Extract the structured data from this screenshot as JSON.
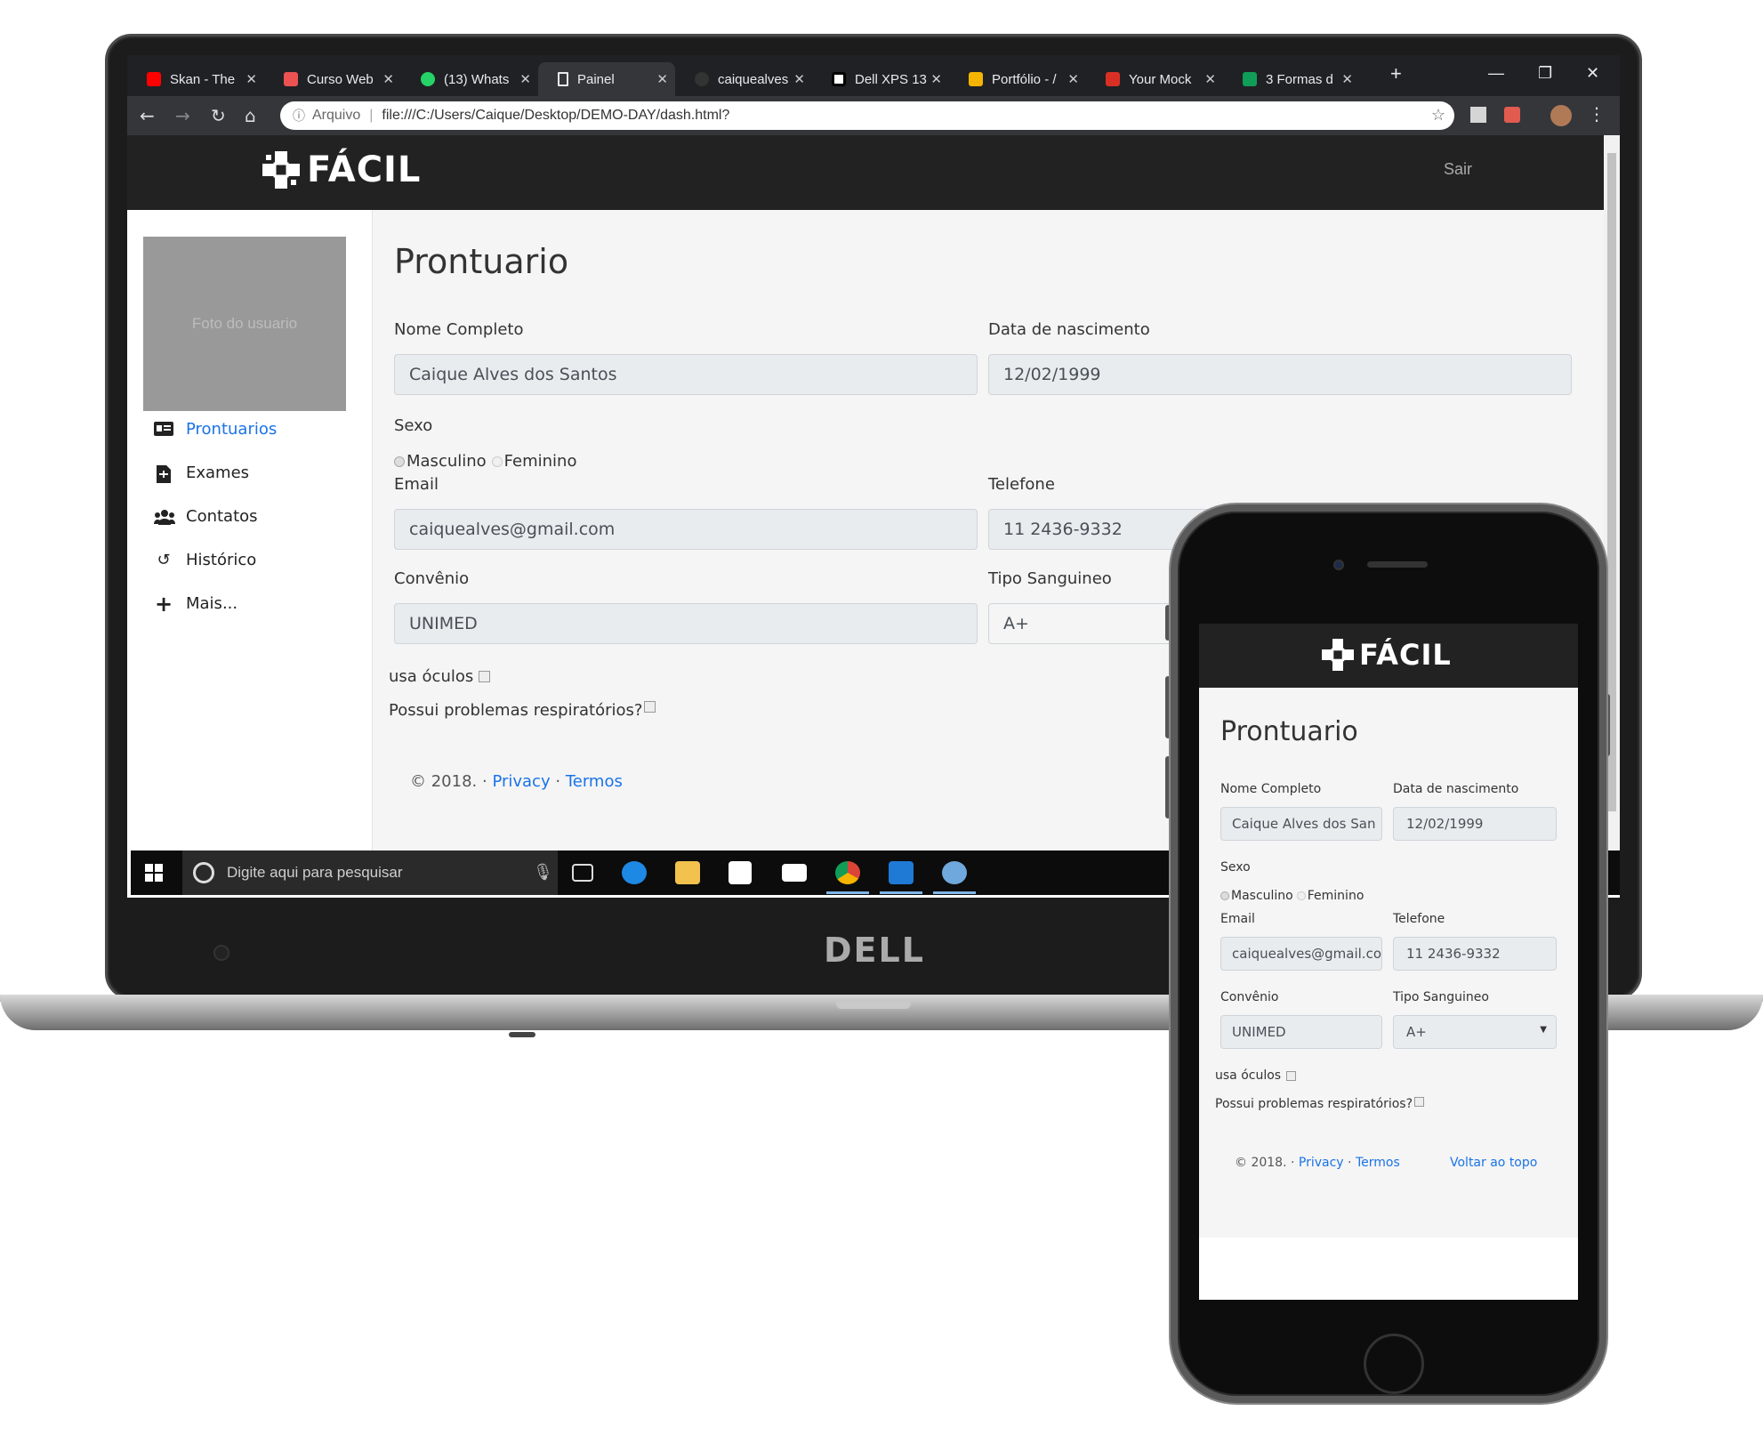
{
  "browser": {
    "tabs": [
      {
        "label": "Skan - The",
        "icon": "youtube-icon",
        "color": "#ff0000"
      },
      {
        "label": "Curso Web",
        "icon": "udemy-icon",
        "color": "#ec5252"
      },
      {
        "label": "(13) Whats",
        "icon": "whatsapp-icon",
        "color": "#25d366"
      },
      {
        "label": "Painel",
        "icon": "document-icon",
        "color": "#e8eaed"
      },
      {
        "label": "caiquealves",
        "icon": "github-icon",
        "color": "#333333"
      },
      {
        "label": "Dell XPS 13",
        "icon": "dell-icon",
        "color": "#ffffff"
      },
      {
        "label": "Portfólio - /",
        "icon": "slides-icon",
        "color": "#f4b400"
      },
      {
        "label": "Your Mock",
        "icon": "gmail-icon",
        "color": "#d93025"
      },
      {
        "label": "3 Formas d",
        "icon": "sheets-icon",
        "color": "#0f9d58"
      }
    ],
    "new_tab_symbol": "+",
    "security_label": "Arquivo",
    "url": "file:///C:/Users/Caique/Desktop/DEMO-DAY/dash.html?"
  },
  "app": {
    "logo_text": "FÁCIL",
    "logout_label": "Sair",
    "photo_placeholder": "Foto do usuario",
    "sidebar": [
      {
        "label": "Prontuarios",
        "icon": "id-card-icon",
        "active": true
      },
      {
        "label": "Exames",
        "icon": "file-medical-icon",
        "active": false
      },
      {
        "label": "Contatos",
        "icon": "users-icon",
        "active": false
      },
      {
        "label": "Histórico",
        "icon": "history-icon",
        "active": false
      },
      {
        "label": "Mais...",
        "icon": "plus-icon",
        "active": false
      }
    ],
    "page_title": "Prontuario",
    "form": {
      "nome_label": "Nome Completo",
      "nome_value": "Caique Alves dos Santos",
      "nascimento_label": "Data de nascimento",
      "nascimento_value": "12/02/1999",
      "sexo_label": "Sexo",
      "sexo_options": [
        "Masculino",
        "Feminino"
      ],
      "email_label": "Email",
      "email_value": "caiquealves@gmail.com",
      "telefone_label": "Telefone",
      "telefone_value": "11 2436-9332",
      "convenio_label": "Convênio",
      "convenio_value": "UNIMED",
      "sangue_label": "Tipo Sanguineo",
      "sangue_value": "A+",
      "oculos_label": "usa óculos",
      "respiratorio_label": "Possui problemas respiratórios?"
    },
    "footer": {
      "copyright": "© 2018. ·",
      "privacy": "Privacy",
      "dot": "·",
      "terms": "Termos",
      "back_to_top": "Voltar ao topo"
    }
  },
  "phone_view": {
    "nome_value": "Caique Alves dos San"
  },
  "taskbar": {
    "search_placeholder": "Digite aqui para pesquisar"
  },
  "laptop_brand": "DELL",
  "colors": {
    "header_bg": "#222222",
    "link": "#1a73e8",
    "page_bg": "#f5f5f5",
    "input_bg": "#e9ecef"
  }
}
